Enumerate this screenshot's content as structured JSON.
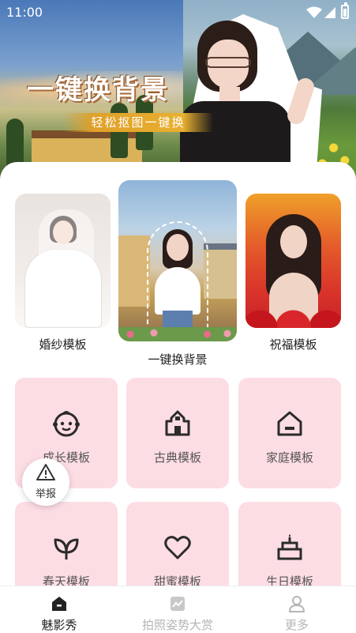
{
  "status_bar": {
    "time": "11:00"
  },
  "banner": {
    "title": "一键换背景",
    "subtitle": "轻松抠图一键换"
  },
  "features": [
    {
      "label": "婚纱模板",
      "icon": "wedding-photo"
    },
    {
      "label": "一键换背景",
      "icon": "background-swap-photo"
    },
    {
      "label": "祝福模板",
      "icon": "blessing-photo"
    }
  ],
  "templates": [
    {
      "label": "成长模板",
      "icon": "baby-face-icon"
    },
    {
      "label": "古典模板",
      "icon": "classical-house-icon"
    },
    {
      "label": "家庭模板",
      "icon": "home-icon"
    },
    {
      "label": "春天模板",
      "icon": "sprout-icon"
    },
    {
      "label": "甜蜜模板",
      "icon": "heart-icon"
    },
    {
      "label": "生日模板",
      "icon": "birthday-cake-icon"
    }
  ],
  "report": {
    "label": "举报"
  },
  "nav": [
    {
      "label": "魅影秀",
      "active": true
    },
    {
      "label": "拍照姿势大赏",
      "active": false
    },
    {
      "label": "更多",
      "active": false
    }
  ],
  "colors": {
    "tile_bg": "#fddde4",
    "nav_active": "#222222",
    "nav_inactive": "#b5b5b5",
    "icon": "#2b2b2b"
  }
}
